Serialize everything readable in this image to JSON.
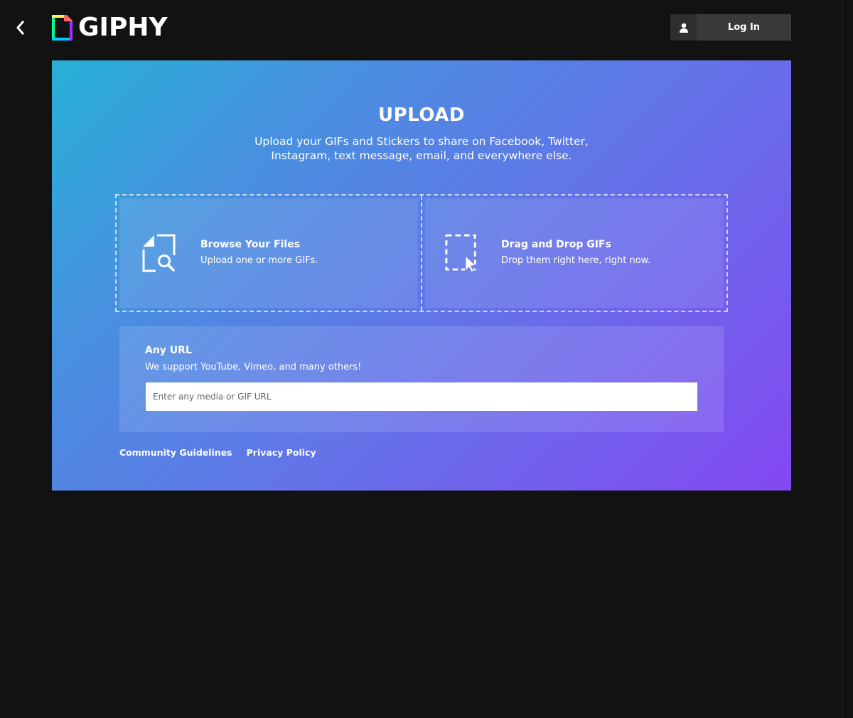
{
  "header": {
    "logo_text": "GIPHY",
    "login_label": "Log In"
  },
  "upload": {
    "title": "UPLOAD",
    "subtitle": "Upload your GIFs and Stickers to share on Facebook, Twitter, Instagram, text message, email, and everywhere else."
  },
  "browse": {
    "title": "Browse Your Files",
    "description": "Upload one or more GIFs."
  },
  "drag_drop": {
    "title": "Drag and Drop GIFs",
    "description": "Drop them right here, right now."
  },
  "url_section": {
    "title": "Any URL",
    "description": "We support YouTube, Vimeo, and many others!",
    "input_placeholder": "Enter any media or GIF URL",
    "input_value": ""
  },
  "footer": {
    "community_guidelines": "Community Guidelines",
    "privacy_policy": "Privacy Policy"
  },
  "icons": {
    "back": "chevron-left-icon",
    "logo": "giphy-logo-icon",
    "user": "user-icon",
    "browse": "file-search-icon",
    "drag": "dashed-select-cursor-icon"
  },
  "colors": {
    "background": "#121212",
    "login_button": "#3a3a3a",
    "gradient_start": "#26b0d6",
    "gradient_end": "#8448f2"
  }
}
